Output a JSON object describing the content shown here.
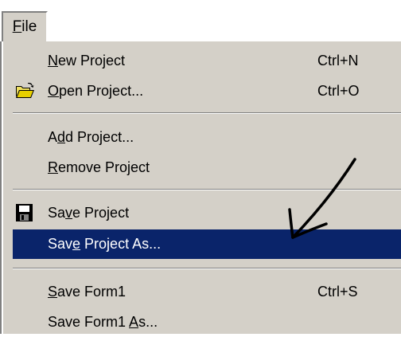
{
  "menubar": {
    "file": {
      "pre": "",
      "u": "F",
      "post": "ile"
    }
  },
  "menu": {
    "new_project": {
      "pre": "",
      "u": "N",
      "post": "ew Project",
      "shortcut": "Ctrl+N"
    },
    "open_project": {
      "pre": "",
      "u": "O",
      "post": "pen Project...",
      "shortcut": "Ctrl+O",
      "icon": "open-folder-icon"
    },
    "add_project": {
      "pre": "A",
      "u": "d",
      "post": "d Project..."
    },
    "remove_project": {
      "pre": "",
      "u": "R",
      "post": "emove Project"
    },
    "save_project": {
      "pre": "Sa",
      "u": "v",
      "post": "e Project",
      "icon": "floppy-disk-icon"
    },
    "save_project_as": {
      "pre": "Sav",
      "u": "e",
      "post": " Project As..."
    },
    "save_form1": {
      "pre": "",
      "u": "S",
      "post": "ave Form1",
      "shortcut": "Ctrl+S"
    },
    "save_form1_as": {
      "pre": "Save Form1 ",
      "u": "A",
      "post": "s..."
    }
  },
  "colors": {
    "menu_bg": "#d4d0c8",
    "highlight": "#0a246a",
    "highlight_text": "#ffffff"
  },
  "annotation": {
    "icon": "hand-drawn-arrow-icon"
  }
}
